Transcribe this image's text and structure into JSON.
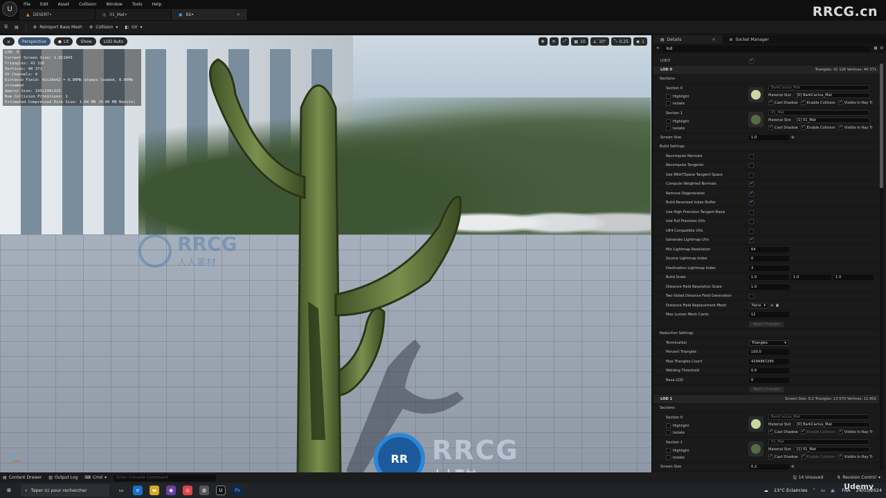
{
  "window": {
    "menu": [
      "File",
      "Edit",
      "Asset",
      "Collision",
      "Window",
      "Tools",
      "Help"
    ],
    "tabs": [
      {
        "label": "DESERT•",
        "icon": "level-icon"
      },
      {
        "label": "01_Mat•",
        "icon": "material-icon"
      },
      {
        "label": "01•",
        "icon": "static-mesh-icon"
      }
    ],
    "watermark": "RRCG.cn"
  },
  "toolbar": {
    "reimport_label": "Reimport Base Mesh",
    "collision_label": "Collision",
    "uv_label": "UV"
  },
  "viewport": {
    "perspective_label": "Perspective",
    "lit_label": "Lit",
    "show_label": "Show",
    "lod_label": "LOD Auto",
    "right_tools": {
      "snap_angle": "10°",
      "grid": "10",
      "scale": "0.25",
      "cam_speed": "1"
    },
    "stats": [
      "LOD:  0",
      "Current Screen Size:  1.011043",
      "Triangles:  41 126",
      "Vertices:  40 371",
      "UV Channels:  4",
      "Distance Field: 42x28x62 = 0.00Mb always loaded, 0.00Mb streamed",
      "Approx Size: 195x100x325",
      "Num Collision Primitives:  1",
      "Estimated Compressed Disk Size: 1.04 MB (0.00 MB Nanite)"
    ],
    "watermark_big": "RRCG",
    "watermark_sub": "人人素材"
  },
  "details": {
    "tab_details": "Details",
    "tab_socket": "Socket Manager",
    "search_value": "lod",
    "lod3_label": "LOD3",
    "lod0": {
      "label": "LOD 0",
      "meta": "Triangles: 41 126   Vertices: 40 371"
    },
    "sections_label": "Sections",
    "section0": {
      "label": "Section 0",
      "material": "BarkCactus_Mat",
      "slot_label": "Material Slot",
      "slot": "[0] BarkCactus_Mat"
    },
    "section1": {
      "label": "Section 1",
      "material": "01_Mat",
      "slot_label": "Material Slot",
      "slot": "[1] 01_Mat"
    },
    "highlight_label": "Highlight",
    "isolate_label": "Isolate",
    "flags": [
      "Cast Shadow",
      "Enable Collision",
      "Visible In Ray Tr"
    ],
    "screen_size_label": "Screen Size",
    "screen_size_lod0": "1.0",
    "build_settings_label": "Build Settings",
    "build": [
      {
        "label": "Recompute Normals",
        "checked": false
      },
      {
        "label": "Recompute Tangents",
        "checked": false
      },
      {
        "label": "Use MikkTSpace Tangent Space",
        "checked": false
      },
      {
        "label": "Compute Weighted Normals",
        "checked": true
      },
      {
        "label": "Remove Degenerates",
        "checked": true
      },
      {
        "label": "Build Reversed Index Buffer",
        "checked": true
      },
      {
        "label": "Use High Precision Tangent Basis",
        "checked": false
      },
      {
        "label": "Use Full Precision UVs",
        "checked": false
      },
      {
        "label": "UE4 Compatible UVs",
        "checked": false
      },
      {
        "label": "Generate Lightmap UVs",
        "checked": true
      }
    ],
    "min_lightmap_label": "Min Lightmap Resolution",
    "min_lightmap": "64",
    "src_lightmap_label": "Source Lightmap Index",
    "src_lightmap": "0",
    "dst_lightmap_label": "Destination Lightmap Index",
    "dst_lightmap": "3",
    "build_scale_label": "Build Scale",
    "build_scale": [
      "1.0",
      "1.0",
      "1.0"
    ],
    "df_res_label": "Distance Field Resolution Scale",
    "df_res": "1.0",
    "two_sided_label": "Two-Sided Distance Field Generation",
    "df_replace_label": "Distance Field Replacement Mesh",
    "df_replace": "None",
    "max_lumen_label": "Max Lumen Mesh Cards",
    "max_lumen": "12",
    "apply_label": "Apply Changes",
    "reduction_label": "Reduction Settings",
    "termination_label": "Termination",
    "termination": "Triangles",
    "percent_tri_label": "Percent Triangles",
    "percent_tri": "100.0",
    "max_tri_label": "Max Triangles Count",
    "max_tri": "4294967295",
    "weld_label": "Welding Threshold",
    "weld": "0.0",
    "base_lod_label": "Base LOD",
    "base_lod": "0",
    "lod1": {
      "label": "LOD 1",
      "meta": "Screen Size: 0.2   Triangles: 13 070   Vertices: 11 602"
    },
    "screen_size_lod1": "0.2"
  },
  "statusbar": {
    "content_drawer": "Content Drawer",
    "output_log": "Output Log",
    "cmd": "Cmd",
    "console_placeholder": "Enter Console Command",
    "unsaved": "14 Unsaved",
    "revision": "Revision Control"
  },
  "taskbar": {
    "search": "Taper ici pour rechercher",
    "weather": "13°C  Éclaircies",
    "lang": "FRA",
    "date": "24/03/2024",
    "brand": "Udemy"
  }
}
